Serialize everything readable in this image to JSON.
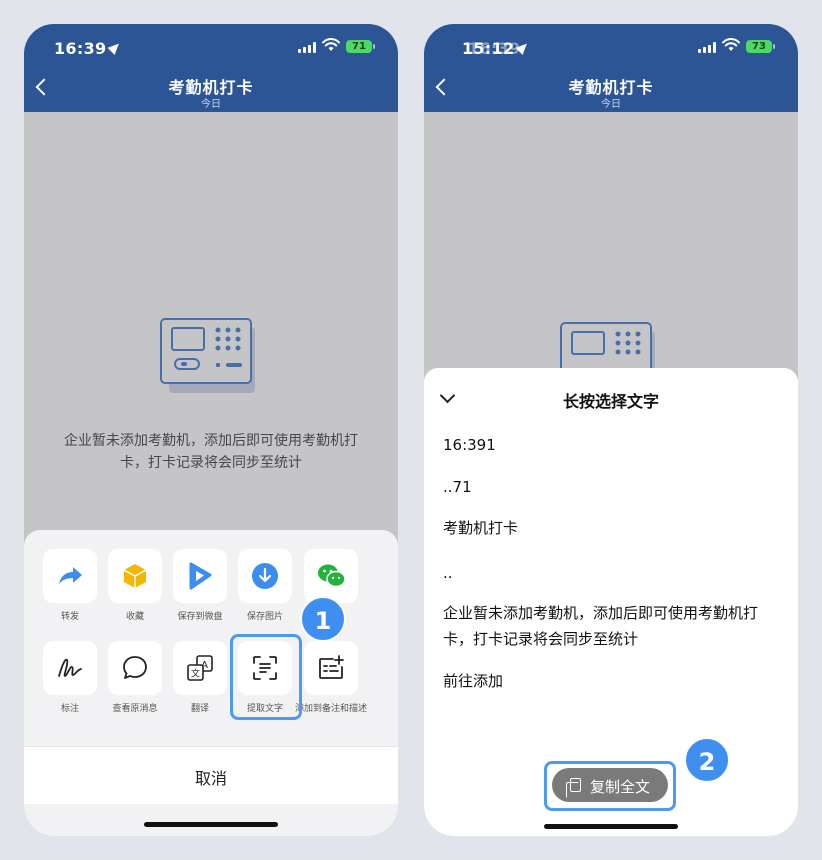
{
  "left_phone": {
    "status": {
      "time": "16:39",
      "battery": "71"
    },
    "nav": {
      "title": "考勤机打卡",
      "subtitle": "今日"
    },
    "empty_state": {
      "message": "企业暂未添加考勤机，添加后即可使用考勤机打卡，打卡记录将会同步至统计"
    },
    "share_sheet": {
      "row1": [
        {
          "label": "转发",
          "icon": "forward-arrow-icon"
        },
        {
          "label": "收藏",
          "icon": "favorite-cube-icon"
        },
        {
          "label": "保存到微盘",
          "icon": "wedrive-icon"
        },
        {
          "label": "保存图片",
          "icon": "download-icon"
        },
        {
          "label": "微信",
          "icon": "wechat-icon"
        }
      ],
      "row2": [
        {
          "label": "标注",
          "icon": "signature-icon"
        },
        {
          "label": "查看原消息",
          "icon": "chat-bubble-icon"
        },
        {
          "label": "翻译",
          "icon": "translate-icon"
        },
        {
          "label": "提取文字",
          "icon": "scan-text-icon"
        },
        {
          "label": "添加到备注和描述",
          "icon": "add-note-icon"
        }
      ],
      "cancel_label": "取消"
    },
    "step_badge": "1"
  },
  "right_phone": {
    "status": {
      "time": "15:12",
      "ghost_time": "16:39",
      "battery": "73"
    },
    "nav": {
      "title": "考勤机打卡",
      "subtitle": "今日"
    },
    "ocr_sheet": {
      "title": "长按选择文字",
      "lines": [
        "16:391",
        "..71",
        "考勤机打卡",
        "..",
        "企业暂未添加考勤机，添加后即可使用考勤机打卡，打卡记录将会同步至统计",
        "前往添加"
      ],
      "copy_button": "复制全文"
    },
    "step_badge": "2"
  },
  "colors": {
    "nav_blue": "#2c5596",
    "highlight": "#4c9bf0",
    "badge": "#3f8ff0"
  }
}
